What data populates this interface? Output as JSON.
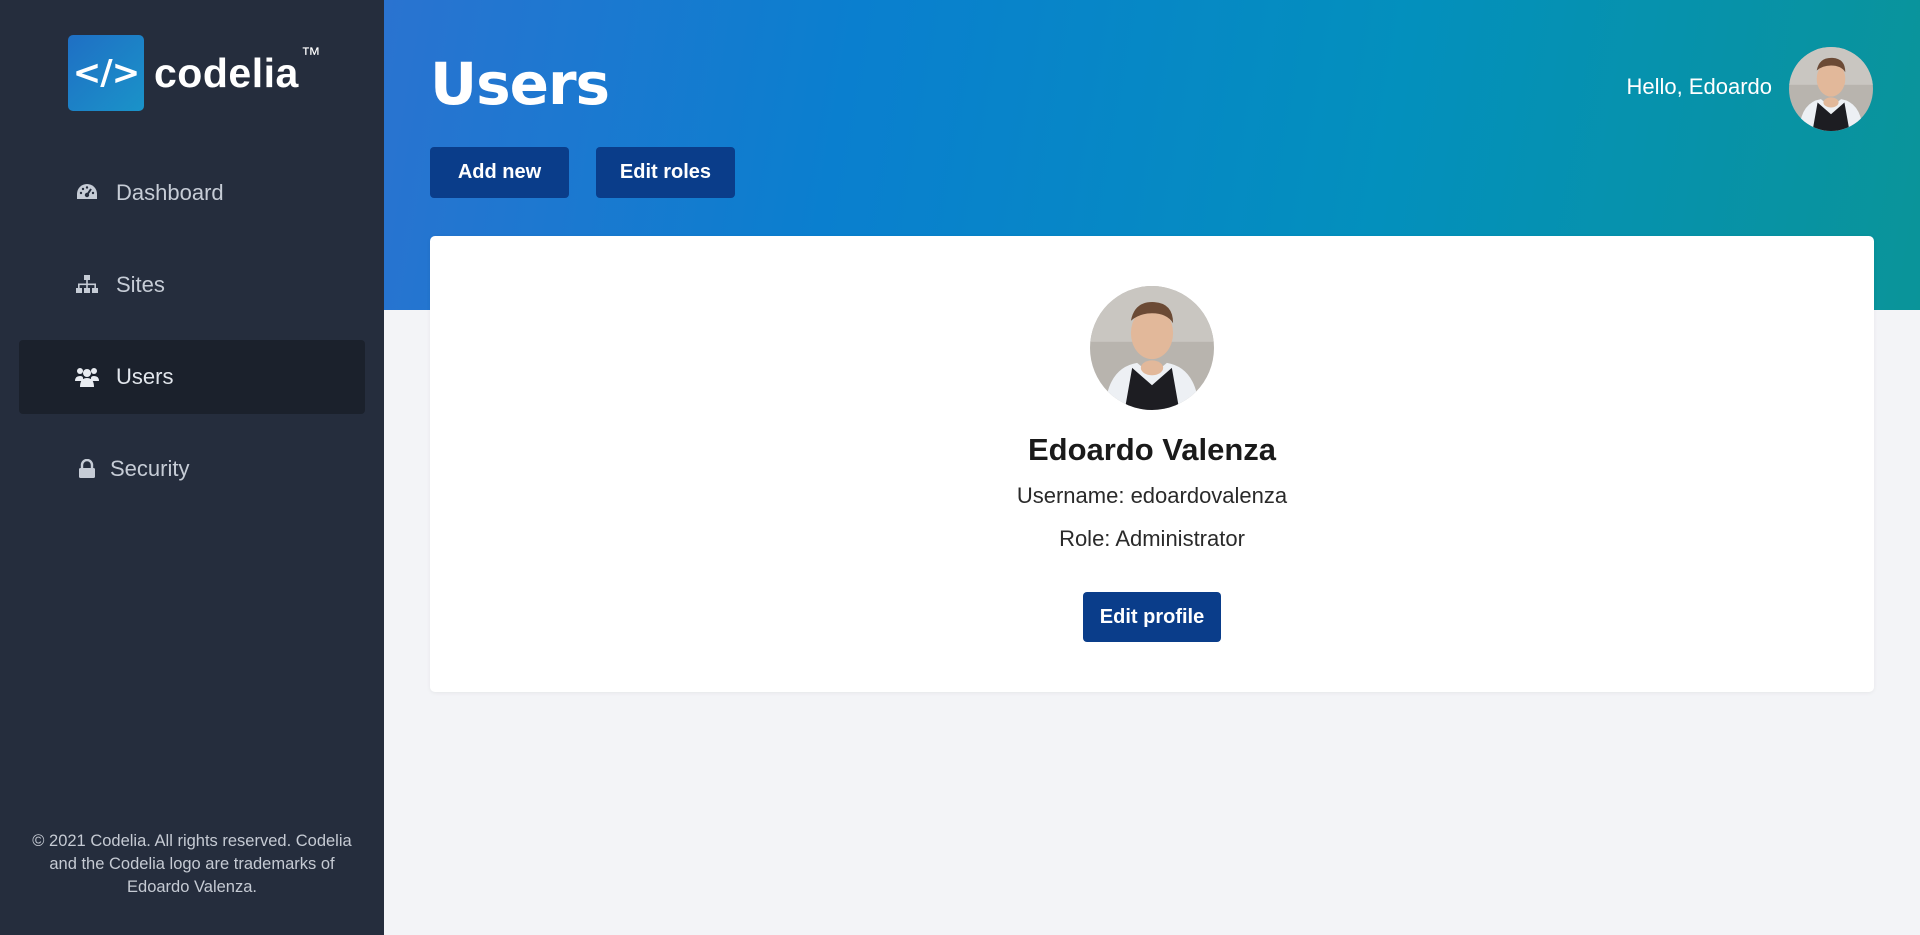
{
  "brand": {
    "name": "codelia",
    "tm": "™",
    "mark": "</>"
  },
  "sidebar": {
    "items": [
      {
        "label": "Dashboard",
        "icon": "dashboard-icon",
        "active": false
      },
      {
        "label": "Sites",
        "icon": "sitemap-icon",
        "active": false
      },
      {
        "label": "Users",
        "icon": "users-icon",
        "active": true
      },
      {
        "label": "Security",
        "icon": "lock-icon",
        "active": false
      }
    ],
    "footer": "© 2021 Codelia. All rights reserved. Codelia and the Codelia logo are trademarks of Edoardo Valenza."
  },
  "header": {
    "title": "Users",
    "add_label": "Add new",
    "roles_label": "Edit roles",
    "greeting": "Hello, Edoardo"
  },
  "profile": {
    "name": "Edoardo Valenza",
    "username_line": "Username: edoardovalenza",
    "role_line": "Role: Administrator",
    "edit_label": "Edit profile"
  },
  "colors": {
    "sidebar_bg": "#252d3d",
    "active_item_bg": "#1b212c",
    "button_bg": "#0a3d8a",
    "header_gradient_start": "#2a73d0",
    "header_gradient_end": "#0a9499",
    "page_bg": "#f3f4f7"
  }
}
